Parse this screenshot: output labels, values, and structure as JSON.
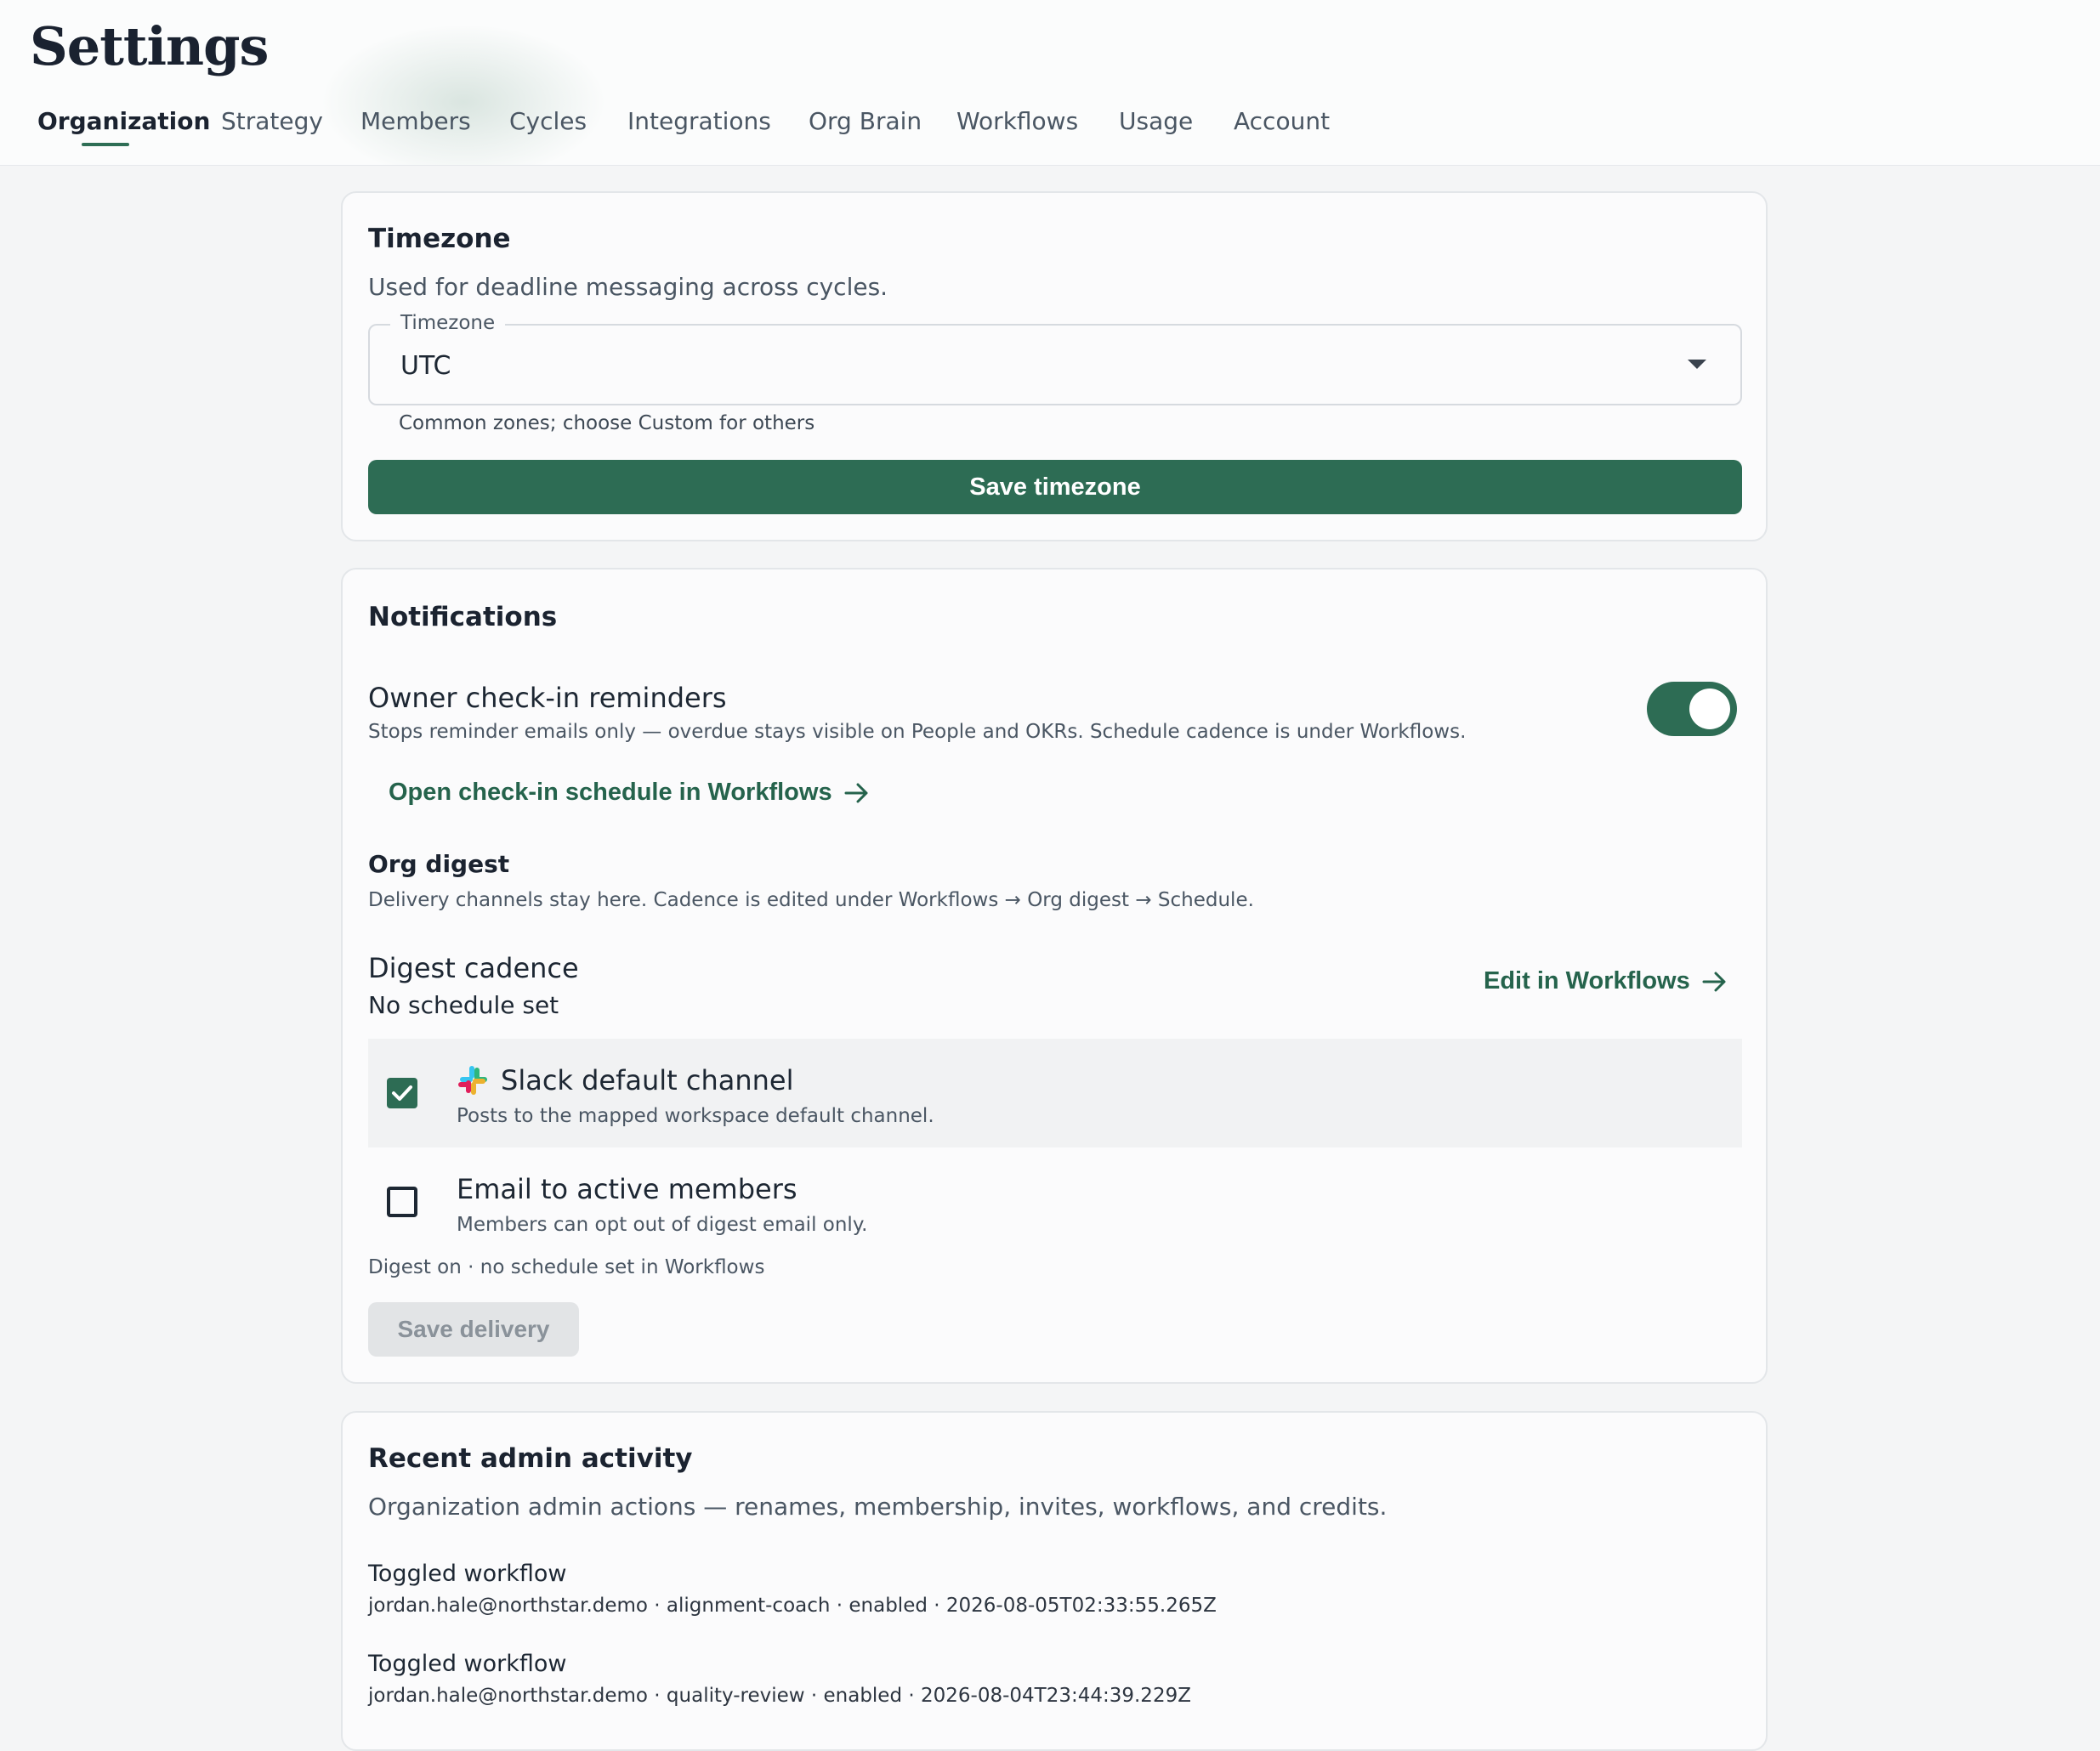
{
  "header": {
    "title": "Settings",
    "tabs": [
      {
        "label": "Organization",
        "active": true
      },
      {
        "label": "Strategy"
      },
      {
        "label": "Members"
      },
      {
        "label": "Cycles"
      },
      {
        "label": "Integrations"
      },
      {
        "label": "Org Brain"
      },
      {
        "label": "Workflows"
      },
      {
        "label": "Usage"
      },
      {
        "label": "Account"
      }
    ]
  },
  "timezone": {
    "title": "Timezone",
    "description": "Used for deadline messaging across cycles.",
    "field_label": "Timezone",
    "value": "UTC",
    "helper": "Common zones; choose Custom for others",
    "save_label": "Save timezone"
  },
  "notifications": {
    "title": "Notifications",
    "reminders": {
      "title": "Owner check-in reminders",
      "subtitle": "Stops reminder emails only — overdue stays visible on People and OKRs. Schedule cadence is under Workflows.",
      "enabled": true,
      "link_label": "Open check-in schedule in Workflows"
    },
    "digest": {
      "heading": "Org digest",
      "description": "Delivery channels stay here. Cadence is edited under Workflows → Org digest → Schedule.",
      "cadence_label": "Digest cadence",
      "cadence_value": "No schedule set",
      "edit_link": "Edit in Workflows",
      "channels": [
        {
          "title": "Slack default channel",
          "subtitle": "Posts to the mapped workspace default channel.",
          "checked": true,
          "icon": "slack-icon"
        },
        {
          "title": "Email to active members",
          "subtitle": "Members can opt out of digest email only.",
          "checked": false
        }
      ],
      "status": "Digest on · no schedule set in Workflows",
      "save_label": "Save delivery"
    }
  },
  "activity": {
    "title": "Recent admin activity",
    "description": "Organization admin actions — renames, membership, invites, workflows, and credits.",
    "items": [
      {
        "action": "Toggled workflow",
        "meta": "jordan.hale@northstar.demo · alignment-coach · enabled · 2026-08-05T02:33:55.265Z"
      },
      {
        "action": "Toggled workflow",
        "meta": "jordan.hale@northstar.demo · quality-review · enabled · 2026-08-04T23:44:39.229Z"
      }
    ]
  },
  "colors": {
    "accent": "#2d6c54",
    "link": "#25634c",
    "background": "#f4f5f6",
    "card": "#fbfbfc"
  }
}
